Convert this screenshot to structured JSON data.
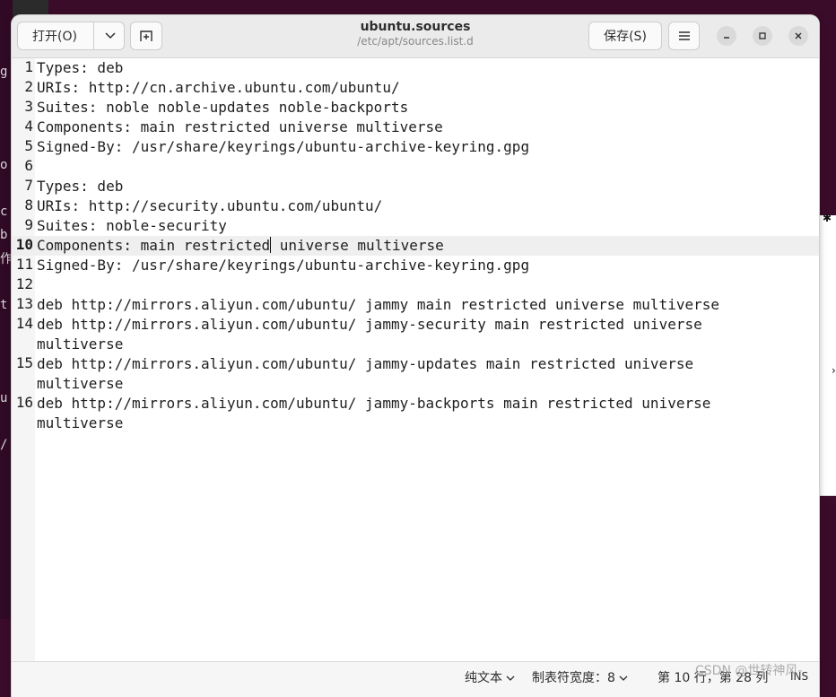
{
  "window": {
    "title": "ubuntu.sources",
    "subtitle": "/etc/apt/sources.list.d"
  },
  "toolbar": {
    "open_label": "打开(O)",
    "save_label": "保存(S)"
  },
  "editor": {
    "current_line": 10,
    "lines": [
      {
        "num": "1",
        "text": "Types: deb"
      },
      {
        "num": "2",
        "text": "URIs: http://cn.archive.ubuntu.com/ubuntu/"
      },
      {
        "num": "3",
        "text": "Suites: noble noble-updates noble-backports"
      },
      {
        "num": "4",
        "text": "Components: main restricted universe multiverse"
      },
      {
        "num": "5",
        "text": "Signed-By: /usr/share/keyrings/ubuntu-archive-keyring.gpg"
      },
      {
        "num": "6",
        "text": ""
      },
      {
        "num": "7",
        "text": "Types: deb"
      },
      {
        "num": "8",
        "text": "URIs: http://security.ubuntu.com/ubuntu/"
      },
      {
        "num": "9",
        "text": "Suites: noble-security"
      },
      {
        "num": "10",
        "text_before_cursor": "Components: main restricted",
        "text_after_cursor": " universe multiverse"
      },
      {
        "num": "11",
        "text": "Signed-By: /usr/share/keyrings/ubuntu-archive-keyring.gpg"
      },
      {
        "num": "12",
        "text": ""
      },
      {
        "num": "13",
        "text": "deb http://mirrors.aliyun.com/ubuntu/ jammy main restricted universe multiverse"
      },
      {
        "num": "14",
        "text": "deb http://mirrors.aliyun.com/ubuntu/ jammy-security main restricted universe multiverse"
      },
      {
        "num": "15",
        "text": "deb http://mirrors.aliyun.com/ubuntu/ jammy-updates main restricted universe multiverse"
      },
      {
        "num": "16",
        "text": "deb http://mirrors.aliyun.com/ubuntu/ jammy-backports main restricted universe multiverse"
      }
    ]
  },
  "statusbar": {
    "language": "纯文本",
    "tab_width": "制表符宽度：8",
    "position": "第 10 行，第 28 列",
    "mode": "INS"
  },
  "watermark": "CSDN @世转神风-",
  "background": {
    "terminal_fragments": [
      "g",
      "o",
      "c",
      "b",
      "作",
      "t",
      "u",
      "/"
    ]
  },
  "icons": {
    "dropdown": "chevron-down-icon",
    "new_tab": "new-tab-icon",
    "menu": "hamburger-menu-icon",
    "minimize": "minimize-icon",
    "maximize": "maximize-icon",
    "close": "close-icon"
  },
  "colors": {
    "current_line_bg": "#efefef",
    "headerbar_bg": "#ebebeb"
  }
}
